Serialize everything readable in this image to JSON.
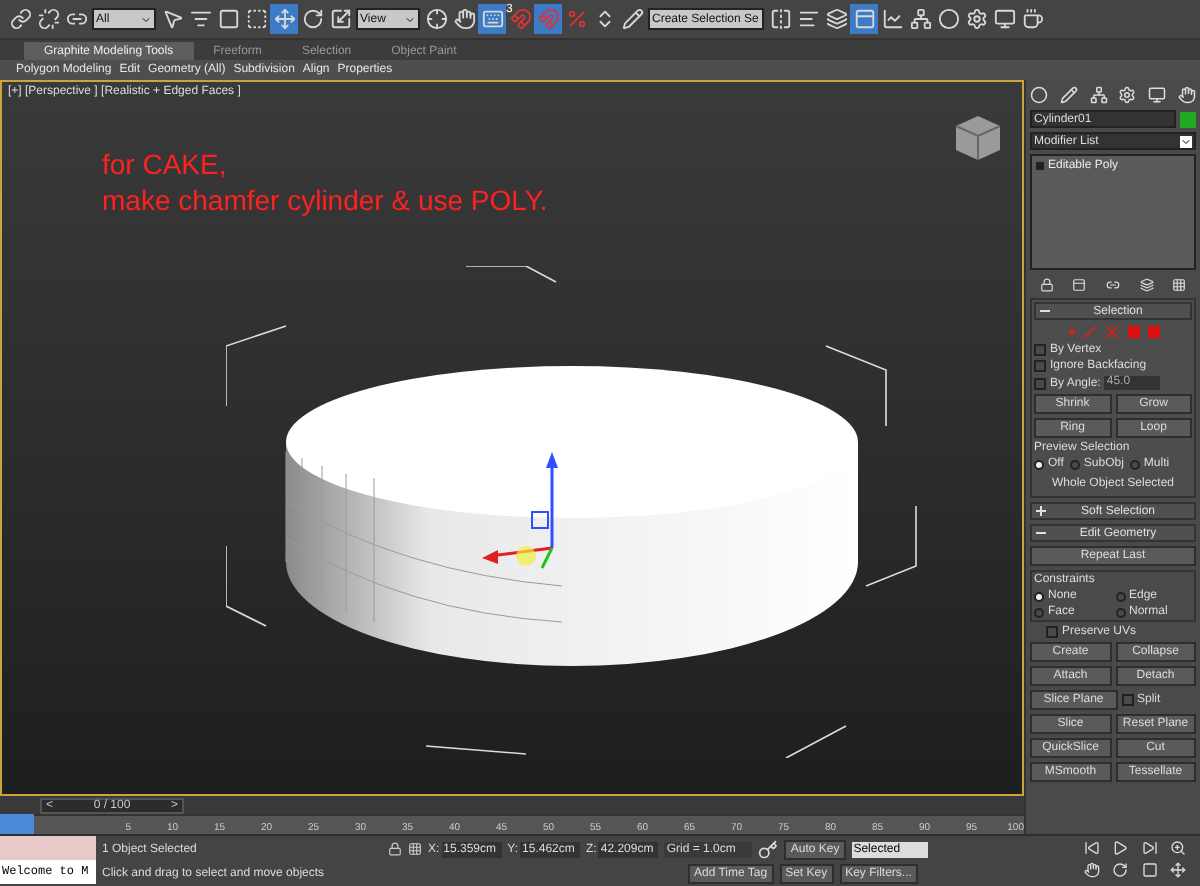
{
  "toolbar": {
    "tools": [
      {
        "kind": "link",
        "selected": false
      },
      {
        "kind": "unlink",
        "selected": false
      },
      {
        "kind": "bind",
        "selected": false
      },
      {
        "kind": "filter",
        "value": "All"
      },
      {
        "kind": "select",
        "selected": false
      },
      {
        "kind": "select-name",
        "selected": false
      },
      {
        "kind": "region",
        "selected": false
      },
      {
        "kind": "crossing",
        "selected": false
      },
      {
        "kind": "move",
        "selected": true
      },
      {
        "kind": "rotate",
        "selected": false
      },
      {
        "kind": "scale",
        "selected": false
      },
      {
        "kind": "coord",
        "value": "View"
      },
      {
        "kind": "pivot",
        "selected": false
      },
      {
        "kind": "manipulate",
        "selected": false
      },
      {
        "kind": "keyboard",
        "selected": true
      },
      {
        "kind": "snap",
        "label": "3",
        "selected": false
      },
      {
        "kind": "angle",
        "selected": true
      },
      {
        "kind": "percent",
        "selected": false
      },
      {
        "kind": "spinner",
        "selected": false
      },
      {
        "kind": "named-set",
        "selected": false
      },
      {
        "kind": "selset",
        "value": "Create Selection Se"
      },
      {
        "kind": "mirror",
        "selected": false
      },
      {
        "kind": "align",
        "selected": false
      },
      {
        "kind": "layers",
        "selected": false
      },
      {
        "kind": "ribbon",
        "selected": true
      },
      {
        "kind": "curve",
        "selected": false
      },
      {
        "kind": "schematic",
        "selected": false
      },
      {
        "kind": "material",
        "selected": false
      },
      {
        "kind": "render-setup",
        "selected": false
      },
      {
        "kind": "frame",
        "selected": false
      },
      {
        "kind": "render",
        "selected": false
      }
    ]
  },
  "ribbon": {
    "tabs": [
      {
        "label": "Graphite Modeling Tools",
        "selected": true
      },
      {
        "label": "Freeform",
        "selected": false
      },
      {
        "label": "Selection",
        "selected": false
      },
      {
        "label": "Object Paint",
        "selected": false
      }
    ],
    "panels": [
      "Polygon Modeling",
      "Edit",
      "Geometry (All)",
      "Subdivision",
      "Align",
      "Properties"
    ]
  },
  "viewport": {
    "label": "[+] [Perspective ] [Realistic + Edged Faces ]",
    "note": [
      "for CAKE,",
      "make chamfer cylinder & use POLY."
    ]
  },
  "command_panel": {
    "object_name": "Cylinder01",
    "modifier_list": "Modifier List",
    "stack": [
      {
        "label": "Editable Poly",
        "selected": false
      }
    ],
    "selection": {
      "title": "Selection",
      "expanded": true,
      "checks": [
        {
          "label": "By Vertex",
          "checked": false
        },
        {
          "label": "Ignore Backfacing",
          "checked": false
        },
        {
          "label": "By Angle:",
          "checked": false,
          "value": "45.0"
        }
      ],
      "buttons": [
        [
          "Shrink",
          "Grow"
        ],
        [
          "Ring",
          "Loop"
        ]
      ],
      "preview_title": "Preview Selection",
      "preview": [
        {
          "label": "Off",
          "selected": true
        },
        {
          "label": "SubObj",
          "selected": false
        },
        {
          "label": "Multi",
          "selected": false
        }
      ],
      "status": "Whole Object Selected"
    },
    "soft_selection": {
      "title": "Soft Selection",
      "expanded": false
    },
    "edit_geometry": {
      "title": "Edit Geometry",
      "expanded": true,
      "repeat": "Repeat Last",
      "constraints_title": "Constraints",
      "constraints": [
        {
          "label": "None",
          "selected": true
        },
        {
          "label": "Edge",
          "selected": false
        },
        {
          "label": "Face",
          "selected": false
        },
        {
          "label": "Normal",
          "selected": false
        }
      ],
      "preserve": {
        "label": "Preserve UVs",
        "checked": false
      },
      "rows": [
        [
          "Create",
          "Collapse"
        ],
        [
          "Attach",
          "Detach"
        ]
      ],
      "slice_plane": "Slice Plane",
      "split": {
        "label": "Split",
        "checked": false
      },
      "slice_rows": [
        [
          "Slice",
          "Reset Plane"
        ],
        [
          "QuickSlice",
          "Cut"
        ]
      ],
      "bottom": [
        "MSmooth",
        "Tessellate"
      ]
    }
  },
  "timeline": {
    "curve_toggle_on": true,
    "level": 0,
    "prev": "<",
    "counter": "0 / 100",
    "next": ">",
    "ticks": [
      "5",
      "10",
      "15",
      "20",
      "25",
      "30",
      "35",
      "40",
      "45",
      "50",
      "55",
      "60",
      "65",
      "70",
      "75",
      "80",
      "85",
      "90",
      "95",
      "100"
    ]
  },
  "status_bar": {
    "listener": "Welcome to M",
    "selected": "1 Object Selected",
    "prompt": "Click and drag to select and move objects",
    "x_label": "X:",
    "x": "15.359cm",
    "y_label": "Y:",
    "y": "15.462cm",
    "z_label": "Z:",
    "z": "42.209cm",
    "grid": "Grid = 1.0cm",
    "add_time_tag": "Add Time Tag",
    "auto_key": "Auto Key",
    "key_mode": "Selected",
    "set_key": "Set Key",
    "key_filters": "Key Filters..."
  }
}
